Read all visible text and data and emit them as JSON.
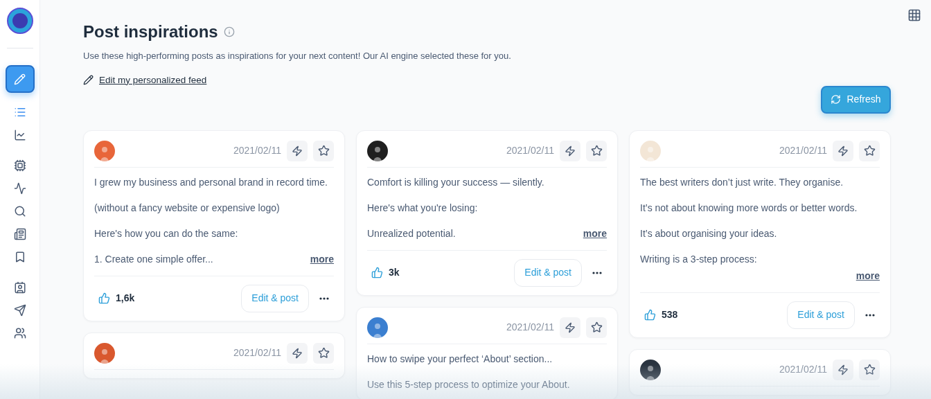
{
  "sidebar": {
    "create_selected": true,
    "groups": [
      [
        {
          "selected": true
        },
        {
          "selected": false
        }
      ],
      [
        {
          "selected": false
        },
        {
          "selected": false
        },
        {
          "selected": false
        },
        {
          "selected": false
        },
        {
          "selected": false
        }
      ],
      [
        {
          "selected": false
        },
        {
          "selected": false
        },
        {
          "selected": false
        }
      ]
    ]
  },
  "header": {
    "title": "Post inspirations",
    "subtitle": "Use these high-performing posts as inspirations for your next content! Our AI engine selected these for you.",
    "edit_link": "Edit my personalized feed",
    "refresh": "Refresh"
  },
  "columns": [
    [
      {
        "color": "#e8663a",
        "date": "2021/02/11",
        "paragraphs": [
          "I grew my business and personal brand in record time.",
          "(without a fancy website or expensive logo)",
          "Here's how you can do the same:",
          "1. Create one simple offer..."
        ],
        "more": "more",
        "more_own_line": false,
        "likes": "1,6k",
        "action": "Edit & post"
      },
      {
        "color": "#d9582e",
        "date": "2021/02/11"
      }
    ],
    [
      {
        "color": "#1f1f1f",
        "date": "2021/02/11",
        "paragraphs": [
          "Comfort is killing your success — silently.",
          "Here's what you're losing:",
          "Unrealized potential."
        ],
        "more": "more",
        "more_own_line": false,
        "likes": "3k",
        "action": "Edit & post"
      },
      {
        "color": "#3b7fd0",
        "date": "2021/02/11",
        "paragraphs": [
          "How to swipe your perfect ‘About’ section...",
          "Use this 5-step process to optimize your About."
        ]
      }
    ],
    [
      {
        "color": "#f3e6d6",
        "date": "2021/02/11",
        "paragraphs": [
          "The best writers don’t just write. They organise.",
          "It’s not about knowing more words or better words.",
          "It’s about organising your ideas.",
          "Writing is a 3-step process:"
        ],
        "more": "more",
        "more_own_line": true,
        "likes": "538",
        "action": "Edit & post"
      },
      {
        "color": "#2a3440",
        "date": "2021/02/11"
      }
    ]
  ]
}
